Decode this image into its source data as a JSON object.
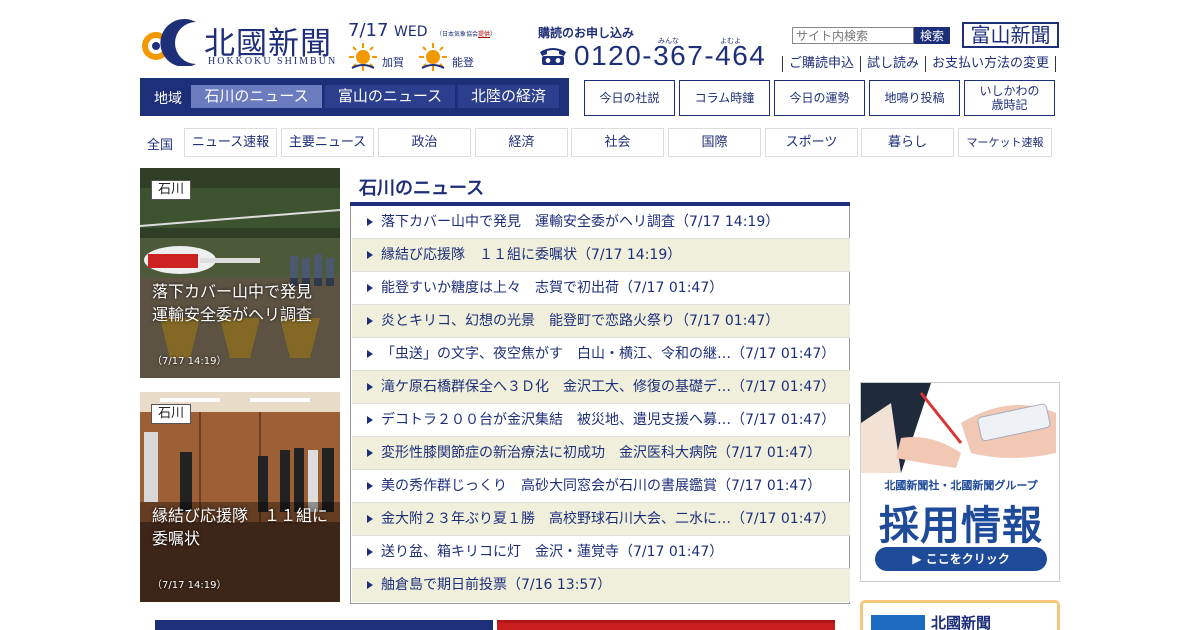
{
  "brand": {
    "name": "北國新聞",
    "romaji": "HOKKOKU SHIMBUN",
    "colors": {
      "primary": "#1e2f7a",
      "accent": "#f29800",
      "alt_row": "#efefdc"
    }
  },
  "date": {
    "date": "7/17",
    "weekday": "WED",
    "credit_prefix": "（日本気象協会",
    "credit_link": "提供",
    "credit_suffix": "）"
  },
  "weather": [
    {
      "area": "加賀",
      "icon": "sun-icon"
    },
    {
      "area": "能登",
      "icon": "sun-icon"
    }
  ],
  "subscribe": {
    "title": "購読のお申し込み",
    "ruby": [
      "みんな",
      "よむよ"
    ],
    "phone": "0120-367-464",
    "icon": "phone-icon"
  },
  "search": {
    "placeholder": "サイト内検索",
    "button": "検索"
  },
  "toyama_button": "富山新聞",
  "util_links": [
    "ご購読申込",
    "試し読み",
    "お支払い方法の変更"
  ],
  "nav_region": {
    "label": "地域",
    "tabs": [
      "石川のニュース",
      "富山のニュース",
      "北陸の経済"
    ],
    "active_index": 0
  },
  "nav_features": [
    "今日の社説",
    "コラム時鐘",
    "今日の運勢",
    "地鳴り投稿",
    "いしかわの\n歳時記"
  ],
  "nav_category": {
    "label": "全国",
    "items": [
      "ニュース速報",
      "主要ニュース",
      "政治",
      "経済",
      "社会",
      "国際",
      "スポーツ",
      "暮らし",
      "マーケット速報"
    ]
  },
  "photo_cards": [
    {
      "tag": "石川",
      "caption": "落下カバー山中で発見　運輸安全委がヘリ調査",
      "time": "（7/17 14:19）"
    },
    {
      "tag": "石川",
      "caption": "縁結び応援隊　１１組に委嘱状",
      "time": "（7/17 14:19）"
    }
  ],
  "news": {
    "title": "石川のニュース",
    "items": [
      "落下カバー山中で発見　運輸安全委がヘリ調査（7/17 14:19）",
      "縁結び応援隊　１１組に委嘱状（7/17 14:19）",
      "能登すいか糖度は上々　志賀で初出荷（7/17 01:47）",
      "炎とキリコ、幻想の光景　能登町で恋路火祭り（7/17 01:47）",
      "「虫送」の文字、夜空焦がす　白山・横江、令和の継…（7/17 01:47）",
      "滝ケ原石橋群保全へ３Ｄ化　金沢工大、修復の基礎デ…（7/17 01:47）",
      "デコトラ２００台が金沢集結　被災地、遺児支援へ募…（7/17 01:47）",
      "変形性膝関節症の新治療法に初成功　金沢医科大病院（7/17 01:47）",
      "美の秀作群じっくり　高砂大同窓会が石川の書展鑑賞（7/17 01:47）",
      "金大附２３年ぶり夏１勝　高校野球石川大会、二水に…（7/17 01:47）",
      "送り盆、箱キリコに灯　金沢・蓮覚寺（7/17 01:47）",
      "舳倉島で期日前投票（7/16 13:57）"
    ]
  },
  "ads": {
    "recruit": {
      "group": "北國新聞社・北國新聞グループ",
      "headline": "採用情報",
      "cta": "▶ ここをクリック"
    },
    "hokkoku": {
      "text": "北國新聞"
    }
  }
}
